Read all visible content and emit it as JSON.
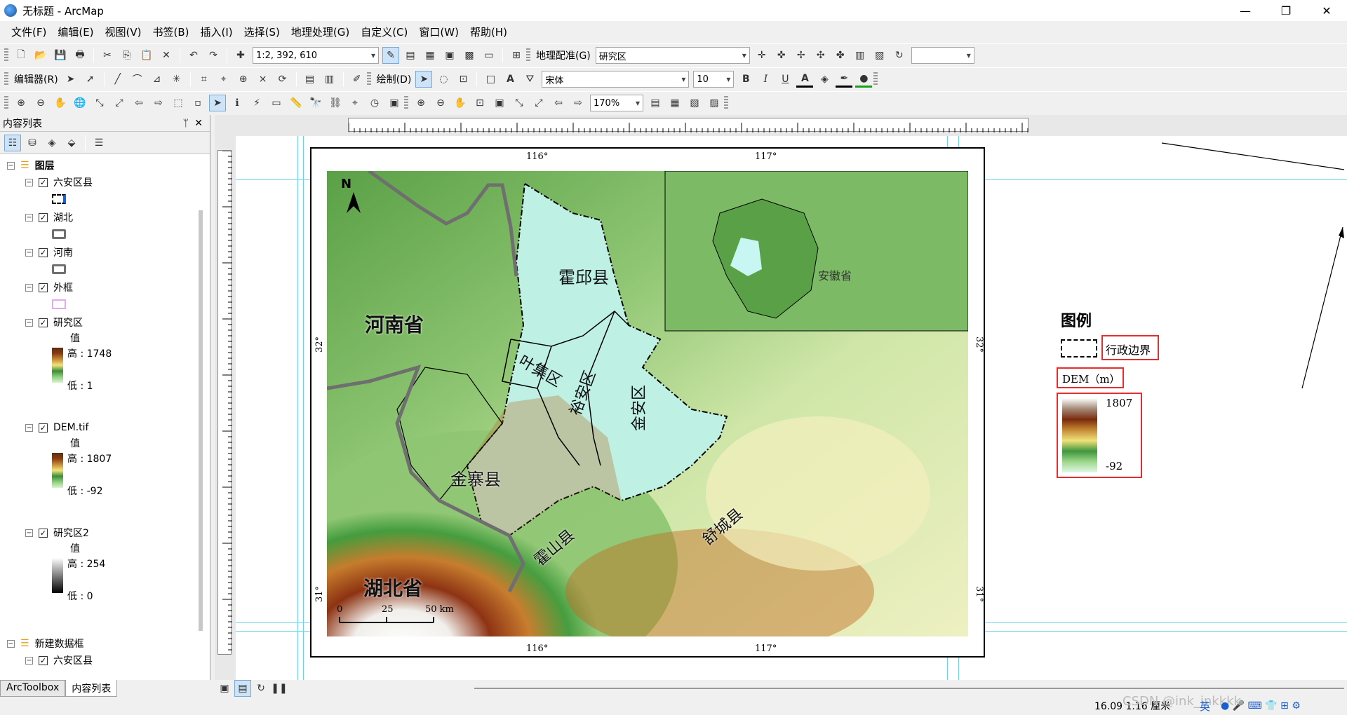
{
  "window": {
    "title": "无标题 - ArcMap",
    "controls": [
      "—",
      "❐",
      "✕"
    ]
  },
  "menu": [
    "文件(F)",
    "编辑(E)",
    "视图(V)",
    "书签(B)",
    "插入(I)",
    "选择(S)",
    "地理处理(G)",
    "自定义(C)",
    "窗口(W)",
    "帮助(H)"
  ],
  "toolbar1": {
    "scale": "1:2, 392, 610",
    "georef_label": "地理配准(G)",
    "georef_layer": "研究区"
  },
  "toolbar2": {
    "editor_label": "编辑器(R)",
    "draw_label": "绘制(D)",
    "font": "宋体",
    "font_size": "10",
    "bold": "B",
    "italic": "I",
    "underline": "U"
  },
  "toolbar3": {
    "zoom": "170%"
  },
  "toc": {
    "title": "内容列表",
    "pin": "ᛘ",
    "close": "✕",
    "root": "图层",
    "layers": [
      {
        "name": "六安区县"
      },
      {
        "name": "湖北"
      },
      {
        "name": "河南"
      },
      {
        "name": "外框"
      },
      {
        "name": "研究区",
        "value_label": "值",
        "high": "高 : 1748",
        "low": "低 : 1"
      },
      {
        "name": "DEM.tif",
        "value_label": "值",
        "high": "高 : 1807",
        "low": "低 : -92"
      },
      {
        "name": "研究区2",
        "value_label": "值",
        "high": "高 : 254",
        "low": "低 : 0"
      }
    ],
    "frame2": "新建数据框",
    "frame2_child": "六安区县"
  },
  "bottom_tabs": [
    "ArcToolbox",
    "内容列表"
  ],
  "map": {
    "coords_top": [
      "116°",
      "117°"
    ],
    "coords_bottom": [
      "116°",
      "117°"
    ],
    "coords_side": [
      "32°",
      "31°"
    ],
    "north": "N",
    "labels": {
      "henan": "河南省",
      "hubei": "湖北省",
      "huoqiu": "霍邱县",
      "yeji": "叶集区",
      "yuan": "裕安区",
      "jinan": "金安区",
      "jinzhai": "金寨县",
      "huoshan": "霍山县",
      "shucheng": "舒城县",
      "anhui": "安徽省"
    },
    "scalebar": [
      "0",
      "25",
      "50 km"
    ]
  },
  "legend": {
    "title": "图例",
    "boundary": "行政边界",
    "dem_title": "DEM（m）",
    "dem_high": "1807",
    "dem_low": "-92"
  },
  "status": {
    "coords": "16.09  1.16 厘米",
    "watermark": "CSDN @ink_inkkkk",
    "ime": "英"
  }
}
